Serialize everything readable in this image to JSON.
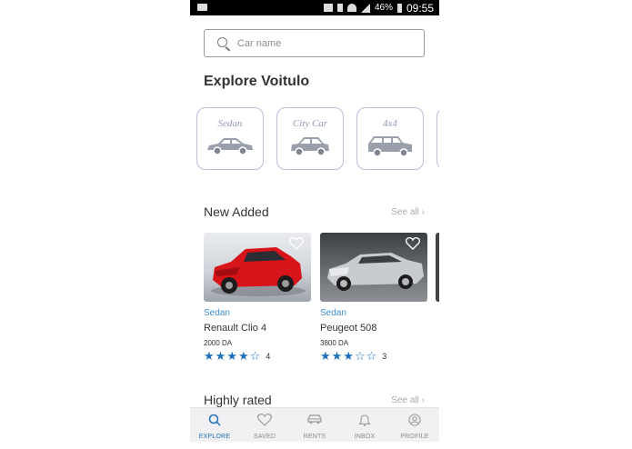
{
  "status_bar": {
    "battery": "46%",
    "time": "09:55"
  },
  "search": {
    "placeholder": "Car name"
  },
  "heading": "Explore Voitulo",
  "categories": [
    {
      "label": "Sedan",
      "icon": "sedan-icon"
    },
    {
      "label": "City Car",
      "icon": "city-car-icon"
    },
    {
      "label": "4x4",
      "icon": "suv-icon"
    }
  ],
  "new_added": {
    "title": "New Added",
    "see_all": "See all"
  },
  "cards": [
    {
      "category": "Sedan",
      "name": "Renault Clio 4",
      "price": "2000 DA",
      "rating": 4,
      "rating_count": "4",
      "image": "red-car-photo"
    },
    {
      "category": "Sedan",
      "name": "Peugeot 508",
      "price": "3800 DA",
      "rating": 3,
      "rating_count": "3",
      "image": "silver-car-photo"
    }
  ],
  "highly_rated": {
    "title": "Highly rated",
    "see_all": "See all"
  },
  "bottom_nav": [
    {
      "label": "EXPLORE",
      "icon": "search-icon",
      "active": true
    },
    {
      "label": "SAVED",
      "icon": "heart-icon",
      "active": false
    },
    {
      "label": "RENTS",
      "icon": "car-icon",
      "active": false
    },
    {
      "label": "INBOX",
      "icon": "bell-icon",
      "active": false
    },
    {
      "label": "PROFILE",
      "icon": "profile-icon",
      "active": false
    }
  ],
  "colors": {
    "accent": "#1f6fb8",
    "category_link": "#3d8fd1",
    "category_border": "#b6bfd6"
  }
}
